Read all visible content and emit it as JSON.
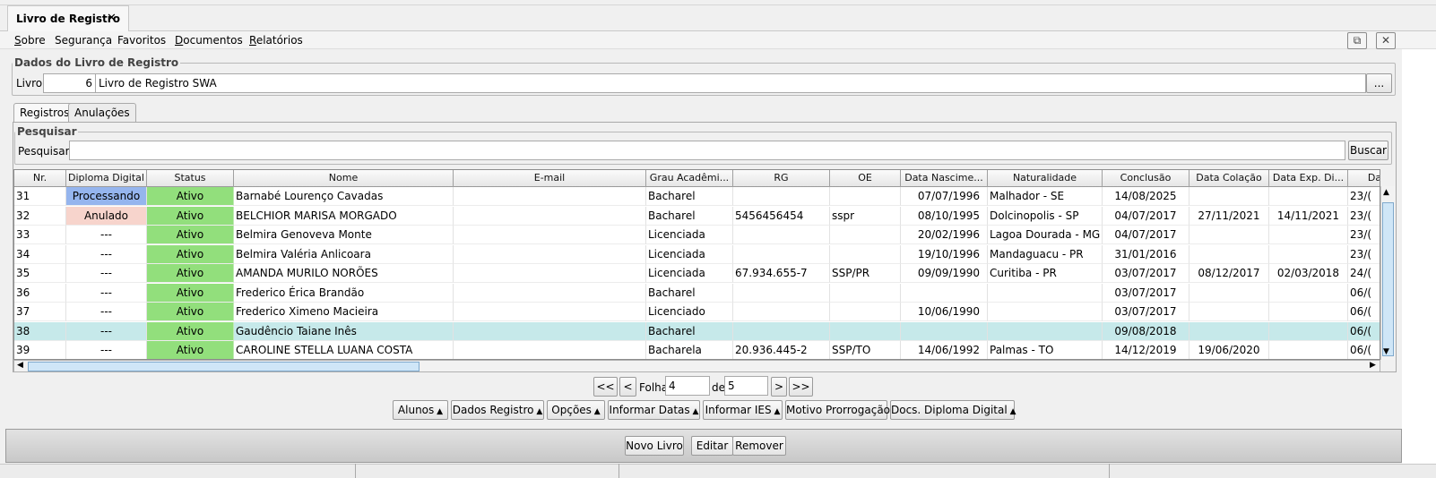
{
  "window": {
    "tab_title": "Livro de Registro",
    "close_glyph": "✕"
  },
  "menu": [
    {
      "label": "Sobre",
      "mnemonic": "S",
      "rest": "obre"
    },
    {
      "label": "Segurança"
    },
    {
      "label": "Favoritos"
    },
    {
      "label": "Documentos",
      "mnemonic": "D",
      "rest": "ocumentos"
    },
    {
      "label": "Relatórios",
      "mnemonic": "R",
      "rest": "elatórios"
    }
  ],
  "window_buttons": {
    "popout_icon": "⧉",
    "close_icon": "✕"
  },
  "livro_group": {
    "legend": "Dados do Livro de Registro",
    "label": "Livro:",
    "number": "6",
    "name": "Livro de Registro SWA",
    "browse": "..."
  },
  "tabs": [
    "Registros",
    "Anulações"
  ],
  "search": {
    "legend": "Pesquisar",
    "label": "Pesquisar:",
    "value": "",
    "button": "Buscar"
  },
  "table": {
    "columns": [
      "Nr.",
      "Diploma Digital",
      "Status",
      "Nome",
      "E-mail",
      "Grau Acadêmi...",
      "RG",
      "OE",
      "Data Nascime...",
      "Naturalidade",
      "Conclusão",
      "Data Colação",
      "Data Exp. Di...",
      "Da"
    ],
    "rows": [
      {
        "nr": "31",
        "diploma": "Processando",
        "status": "Ativo",
        "nome": "Barnabé Lourenço Cavadas",
        "email": "",
        "grau": "Bacharel",
        "rg": "",
        "oe": "",
        "nasc": "07/07/1996",
        "nat": "Malhador - SE",
        "conc": "14/08/2025",
        "colacao": "",
        "exp": "",
        "da": "23/("
      },
      {
        "nr": "32",
        "diploma": "Anulado",
        "status": "Ativo",
        "nome": "BELCHIOR MARISA MORGADO",
        "email": "",
        "grau": "Bacharel",
        "rg": "5456456454",
        "oe": "sspr",
        "nasc": "08/10/1995",
        "nat": "Dolcinopolis - SP",
        "conc": "04/07/2017",
        "colacao": "27/11/2021",
        "exp": "14/11/2021",
        "da": "23/("
      },
      {
        "nr": "33",
        "diploma": "---",
        "status": "Ativo",
        "nome": "Belmira Genoveva Monte",
        "email": "",
        "grau": "Licenciada",
        "rg": "",
        "oe": "",
        "nasc": "20/02/1996",
        "nat": "Lagoa Dourada - MG",
        "conc": "04/07/2017",
        "colacao": "",
        "exp": "",
        "da": "23/("
      },
      {
        "nr": "34",
        "diploma": "---",
        "status": "Ativo",
        "nome": "Belmira Valéria Anlicoara",
        "email": "",
        "grau": "Licenciada",
        "rg": "",
        "oe": "",
        "nasc": "19/10/1996",
        "nat": "Mandaguacu - PR",
        "conc": "31/01/2016",
        "colacao": "",
        "exp": "",
        "da": "23/("
      },
      {
        "nr": "35",
        "diploma": "---",
        "status": "Ativo",
        "nome": "AMANDA MURILO NORÕES",
        "email": "",
        "grau": "Licenciada",
        "rg": "67.934.655-7",
        "oe": "SSP/PR",
        "nasc": "09/09/1990",
        "nat": "Curitiba - PR",
        "conc": "03/07/2017",
        "colacao": "08/12/2017",
        "exp": "02/03/2018",
        "da": "24/("
      },
      {
        "nr": "36",
        "diploma": "---",
        "status": "Ativo",
        "nome": "Frederico Érica Brandão",
        "email": "",
        "grau": "Bacharel",
        "rg": "",
        "oe": "",
        "nasc": "",
        "nat": "",
        "conc": "03/07/2017",
        "colacao": "",
        "exp": "",
        "da": "06/("
      },
      {
        "nr": "37",
        "diploma": "---",
        "status": "Ativo",
        "nome": "Frederico Ximeno Macieira",
        "email": "",
        "grau": "Licenciado",
        "rg": "",
        "oe": "",
        "nasc": "10/06/1990",
        "nat": "",
        "conc": "03/07/2017",
        "colacao": "",
        "exp": "",
        "da": "06/("
      },
      {
        "nr": "38",
        "diploma": "---",
        "status": "Ativo",
        "nome": "Gaudêncio Taiane Inês",
        "email": "",
        "grau": "Bacharel",
        "rg": "",
        "oe": "",
        "nasc": "",
        "nat": "",
        "conc": "09/08/2018",
        "colacao": "",
        "exp": "",
        "da": "06/("
      },
      {
        "nr": "39",
        "diploma": "---",
        "status": "Ativo",
        "nome": "CAROLINE STELLA LUANA COSTA",
        "email": "",
        "grau": "Bacharela",
        "rg": "20.936.445-2",
        "oe": "SSP/TO",
        "nasc": "14/06/1992",
        "nat": "Palmas - TO",
        "conc": "14/12/2019",
        "colacao": "19/06/2020",
        "exp": "",
        "da": "06/("
      }
    ],
    "selected_row": 7
  },
  "pager": {
    "first": "<<",
    "prev": "<",
    "folha_label": "Folha",
    "page": "4",
    "de_label": "de",
    "total": "5",
    "next": ">",
    "last": ">>"
  },
  "actions": [
    "Alunos",
    "Dados Registro",
    "Opções",
    "Informar Datas",
    "Informar IES",
    "Motivo Prorrogação",
    "Docs. Diploma Digital"
  ],
  "actions_dropdown": [
    true,
    true,
    true,
    true,
    true,
    false,
    true
  ],
  "footer_buttons": [
    "Novo Livro",
    "Editar",
    "Remover"
  ],
  "colors": {
    "ativo": "#92df7c",
    "processando": "#95b5ee",
    "anulado": "#f7d4cc",
    "selected": "#c6e9ea"
  }
}
